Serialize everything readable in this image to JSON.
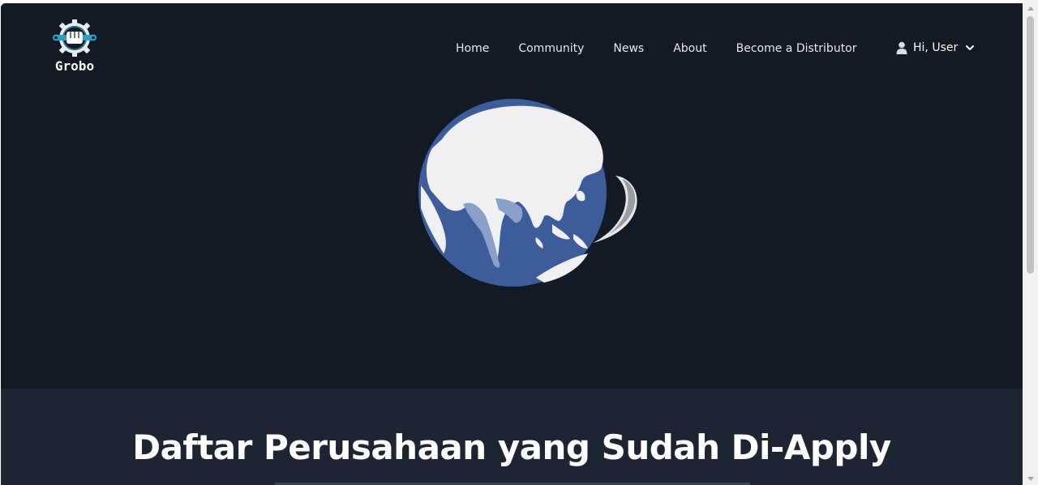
{
  "brand": {
    "name": "Grobo"
  },
  "nav": {
    "items": [
      {
        "label": "Home"
      },
      {
        "label": "Community"
      },
      {
        "label": "News"
      },
      {
        "label": "About"
      },
      {
        "label": "Become a Distributor"
      }
    ]
  },
  "user": {
    "greeting": "Hi, User",
    "icon": "user-icon",
    "menu_icon": "chevron-down-icon"
  },
  "hero": {
    "graphic": "rotating-globe-loader"
  },
  "section": {
    "title": "Daftar Perusahaan yang Sudah Di-Apply"
  },
  "colors": {
    "background": "#131a25",
    "section_background": "#1c2531",
    "globe_ocean": "#3b5b99",
    "globe_land": "#f0f0f2",
    "text": "#ffffff"
  }
}
